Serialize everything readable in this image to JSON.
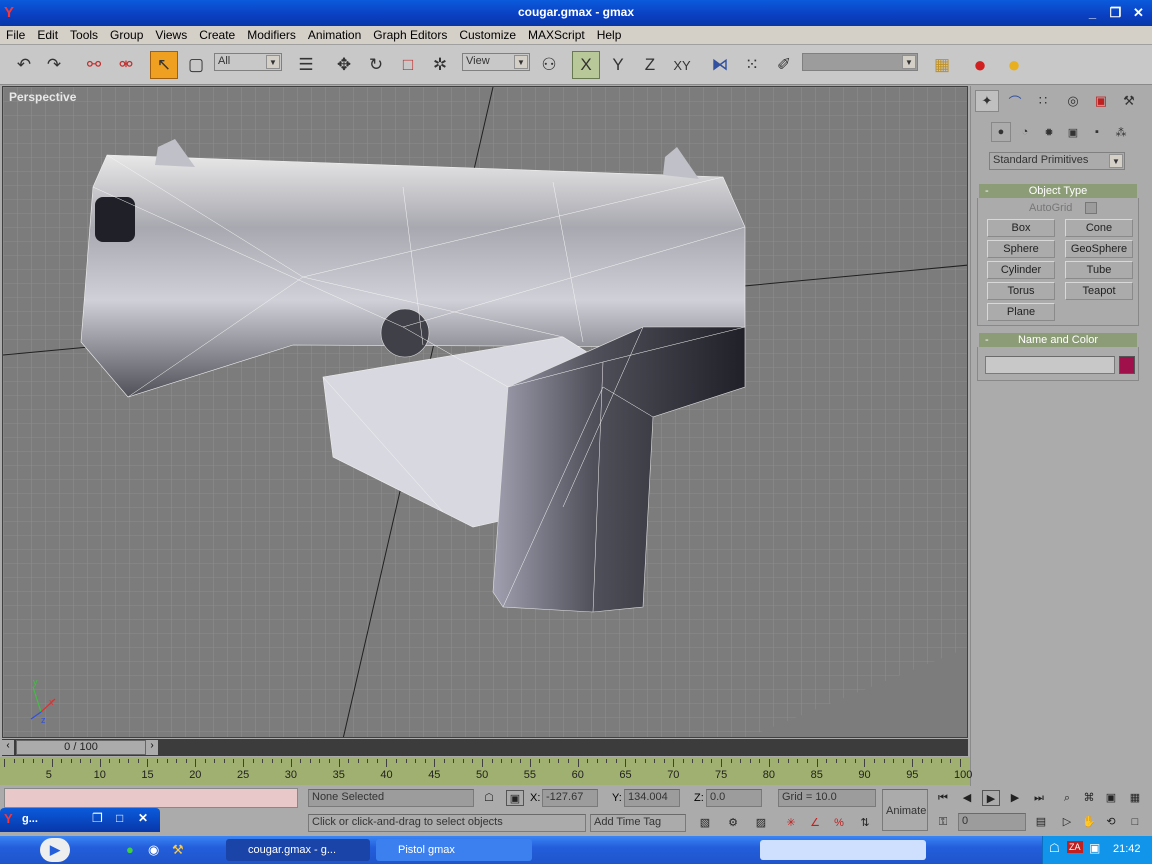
{
  "window": {
    "title": "cougar.gmax - gmax"
  },
  "menu": [
    "File",
    "Edit",
    "Tools",
    "Group",
    "Views",
    "Create",
    "Modifiers",
    "Animation",
    "Graph Editors",
    "Customize",
    "MAXScript",
    "Help"
  ],
  "toolbar": {
    "selection_filter": "All",
    "ref_coord": "View",
    "axis_x": "X",
    "axis_y": "Y",
    "axis_z": "Z",
    "axis_xy": "XY",
    "named_selection": ""
  },
  "viewport": {
    "label": "Perspective"
  },
  "command_panel": {
    "category": "Standard Primitives",
    "object_type": {
      "title": "Object Type",
      "autogrid": "AutoGrid",
      "buttons": [
        "Box",
        "Cone",
        "Sphere",
        "GeoSphere",
        "Cylinder",
        "Tube",
        "Torus",
        "Teapot",
        "Plane"
      ]
    },
    "name_color": {
      "title": "Name and Color",
      "name_value": "",
      "color": "#a0104a"
    },
    "minus": "-"
  },
  "timeline": {
    "frame": "0 / 100",
    "ticks": [
      "5",
      "10",
      "15",
      "20",
      "25",
      "30",
      "35",
      "40",
      "45",
      "50",
      "55",
      "60",
      "65",
      "70",
      "75",
      "80",
      "85",
      "90",
      "95",
      "100"
    ]
  },
  "status": {
    "selection": "None Selected",
    "prompt": "Click or click-and-drag to select objects",
    "x_label": "X:",
    "x_value": "-127.67",
    "y_label": "Y:",
    "y_value": "134.004",
    "z_label": "Z:",
    "z_value": "0.0",
    "grid": "Grid = 10.0",
    "add_time_tag": "Add Time Tag",
    "animate": "Animate",
    "frame_field": "0"
  },
  "floating_window": {
    "label": "g..."
  },
  "taskbar": {
    "tasks": [
      "cougar.gmax - g...",
      "Pistol gmax"
    ],
    "clock": "21:42",
    "tray_label": "ZA"
  }
}
